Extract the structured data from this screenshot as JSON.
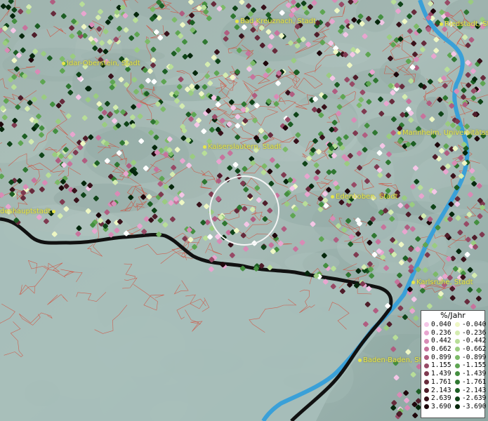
{
  "cities": [
    {
      "name": "Bad Kreuznach, Stadt"
    },
    {
      "name": "Riedstadt, St"
    },
    {
      "name": "Idar-Oberstein, Stadt"
    },
    {
      "name": "Mannheim, Universitätsst"
    },
    {
      "name": "Kaiserslautern, Stadt"
    },
    {
      "name": "Edenkoben, Stadt"
    },
    {
      "name": "deshauptstadt"
    },
    {
      "name": "Karlsruhe, Stadt"
    },
    {
      "name": "Baden-Baden, Sta"
    }
  ],
  "legend": {
    "title": "%/Jahr",
    "positive": [
      {
        "label": "0.040",
        "color": "#f4c6e6"
      },
      {
        "label": "0.236",
        "color": "#e8a5cf"
      },
      {
        "label": "0.442",
        "color": "#d98bb6"
      },
      {
        "label": "0.662",
        "color": "#c7739c"
      },
      {
        "label": "0.899",
        "color": "#b05d80"
      },
      {
        "label": "1.155",
        "color": "#974a66"
      },
      {
        "label": "1.439",
        "color": "#7f3a50"
      },
      {
        "label": "1.761",
        "color": "#672b3c"
      },
      {
        "label": "2.143",
        "color": "#4f1d2a"
      },
      {
        "label": "2.639",
        "color": "#38111a"
      },
      {
        "label": "3.690",
        "color": "#1e060b"
      }
    ],
    "negative": [
      {
        "label": "-0.040",
        "color": "#eef7c4"
      },
      {
        "label": "-0.236",
        "color": "#d4ecb0"
      },
      {
        "label": "-0.442",
        "color": "#b8de98"
      },
      {
        "label": "-0.662",
        "color": "#9acc80"
      },
      {
        "label": "-0.899",
        "color": "#7cba68"
      },
      {
        "label": "-1.155",
        "color": "#5ea552"
      },
      {
        "label": "-1.439",
        "color": "#448f40"
      },
      {
        "label": "-1.761",
        "color": "#2f7731"
      },
      {
        "label": "-2.143",
        "color": "#1d5e24"
      },
      {
        "label": "-2.639",
        "color": "#0f4418"
      },
      {
        "label": "-3.690",
        "color": "#05270c"
      }
    ]
  },
  "colors": {
    "terrain": "#8fa8a2",
    "border_lines": "#d8402c",
    "river": "#3aa0d8",
    "frontier": "#111111",
    "city_label": "#e6e64a",
    "white_point": "#ffffff"
  }
}
